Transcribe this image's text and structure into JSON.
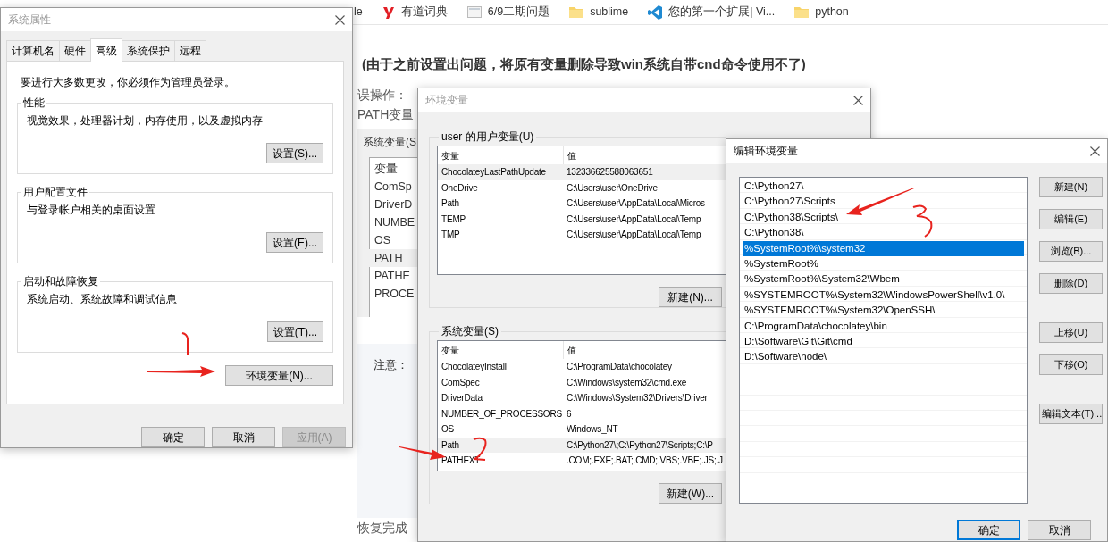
{
  "bookmarks": [
    {
      "kind": "none",
      "label": "le"
    },
    {
      "kind": "youdao",
      "label": "有道词典"
    },
    {
      "kind": "page",
      "label": "6/9二期问题"
    },
    {
      "kind": "folder",
      "label": "sublime"
    },
    {
      "kind": "vscode",
      "label": "您的第一个扩展| Vi..."
    },
    {
      "kind": "folder",
      "label": "python"
    }
  ],
  "article": {
    "heading": "(由于之前设置出问题，将原有变量删除导致win系统自带cnd命令使用不了)",
    "mistake_label": "误操作：",
    "path_line": "PATH变量",
    "screenshot": {
      "group_label": "系统变量(S",
      "column": "变量",
      "rows": [
        {
          "name": "ComSp",
          "selected": false
        },
        {
          "name": "DriverD",
          "selected": false
        },
        {
          "name": "NUMBE",
          "selected": false
        },
        {
          "name": "OS",
          "selected": false
        },
        {
          "name": "PATH",
          "selected": true
        },
        {
          "name": "PATHE",
          "selected": false
        },
        {
          "name": "PROCE",
          "selected": false
        }
      ]
    },
    "note_label": "注意：",
    "footer_line": "恢复完成"
  },
  "system_properties": {
    "title": "系统属性",
    "tabs": [
      {
        "label": "计算机名",
        "selected": false
      },
      {
        "label": "硬件",
        "selected": false
      },
      {
        "label": "高级",
        "selected": true
      },
      {
        "label": "系统保护",
        "selected": false
      },
      {
        "label": "远程",
        "selected": false
      }
    ],
    "notice": "要进行大多数更改，你必须作为管理员登录。",
    "groups": [
      {
        "title": "性能",
        "text": "视觉效果，处理器计划，内存使用，以及虚拟内存",
        "button": "设置(S)..."
      },
      {
        "title": "用户配置文件",
        "text": "与登录帐户相关的桌面设置",
        "button": "设置(E)..."
      },
      {
        "title": "启动和故障恢复",
        "text": "系统启动、系统故障和调试信息",
        "button": "设置(T)..."
      }
    ],
    "env_button": "环境变量(N)...",
    "buttons": [
      {
        "label": "确定",
        "disabled": false
      },
      {
        "label": "取消",
        "disabled": false
      },
      {
        "label": "应用(A)",
        "disabled": true
      }
    ]
  },
  "environment_variables": {
    "title": "环境变量",
    "user_group": "user 的用户变量(U)",
    "columns": [
      "变量",
      "值"
    ],
    "user_rows": [
      {
        "name": "ChocolateyLastPathUpdate",
        "value": "132336625588063651",
        "selected": true
      },
      {
        "name": "OneDrive",
        "value": "C:\\Users\\user\\OneDrive",
        "selected": false
      },
      {
        "name": "Path",
        "value": "C:\\Users\\user\\AppData\\Local\\Micros",
        "selected": false
      },
      {
        "name": "TEMP",
        "value": "C:\\Users\\user\\AppData\\Local\\Temp",
        "selected": false
      },
      {
        "name": "TMP",
        "value": "C:\\Users\\user\\AppData\\Local\\Temp",
        "selected": false
      }
    ],
    "user_button": "新建(N)...",
    "system_group": "系统变量(S)",
    "system_columns": [
      "变量",
      "值"
    ],
    "system_rows": [
      {
        "name": "ChocolateyInstall",
        "value": "C:\\ProgramData\\chocolatey",
        "selected": false
      },
      {
        "name": "ComSpec",
        "value": "C:\\Windows\\system32\\cmd.exe",
        "selected": false
      },
      {
        "name": "DriverData",
        "value": "C:\\Windows\\System32\\Drivers\\Driver",
        "selected": false
      },
      {
        "name": "NUMBER_OF_PROCESSORS",
        "value": "6",
        "selected": false
      },
      {
        "name": "OS",
        "value": "Windows_NT",
        "selected": false
      },
      {
        "name": "Path",
        "value": "C:\\Python27\\;C:\\Python27\\Scripts;C:\\P",
        "selected": true
      },
      {
        "name": "PATHEXT",
        "value": ".COM;.EXE;.BAT;.CMD;.VBS;.VBE;.JS;.J",
        "selected": false
      }
    ],
    "system_button": "新建(W)..."
  },
  "edit_variable": {
    "title": "编辑环境变量",
    "items": [
      {
        "text": "C:\\Python27\\",
        "selected": false
      },
      {
        "text": "C:\\Python27\\Scripts",
        "selected": false
      },
      {
        "text": "C:\\Python38\\Scripts\\",
        "selected": false
      },
      {
        "text": "C:\\Python38\\",
        "selected": false
      },
      {
        "text": "%SystemRoot%\\system32",
        "selected": true
      },
      {
        "text": "%SystemRoot%",
        "selected": false
      },
      {
        "text": "%SystemRoot%\\System32\\Wbem",
        "selected": false
      },
      {
        "text": "%SYSTEMROOT%\\System32\\WindowsPowerShell\\v1.0\\",
        "selected": false
      },
      {
        "text": "%SYSTEMROOT%\\System32\\OpenSSH\\",
        "selected": false
      },
      {
        "text": "C:\\ProgramData\\chocolatey\\bin",
        "selected": false
      },
      {
        "text": "D:\\Software\\Git\\Git\\cmd",
        "selected": false
      },
      {
        "text": "D:\\Software\\node\\",
        "selected": false
      }
    ],
    "button_groups": [
      [
        "新建(N)",
        "编辑(E)",
        "浏览(B)...",
        "删除(D)"
      ],
      [
        "上移(U)",
        "下移(O)"
      ],
      [
        "编辑文本(T)..."
      ]
    ],
    "buttons": [
      {
        "label": "确定",
        "focused": true
      },
      {
        "label": "取消",
        "focused": false
      }
    ]
  }
}
